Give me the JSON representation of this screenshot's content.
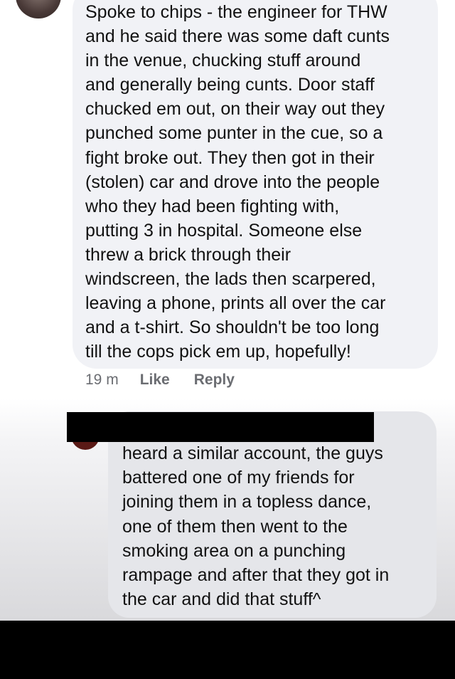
{
  "comment_1": {
    "text": "Spoke to chips - the engineer for THW\nand he said there was some daft cunts\nin the venue, chucking stuff around\nand generally being cunts. Door staff\nchucked em out, on their way out they\npunched some punter in the cue, so a\nfight broke out. They then got in their\n(stolen) car and drove into the people\nwho they had been fighting with,\nputting 3 in hospital. Someone else\nthrew a brick through their\nwindscreen, the lads then scarpered,\nleaving a phone, prints all over the car\nand a t-shirt. So shouldn't be too long\ntill the cops pick em up, hopefully!",
    "timestamp": "19 m",
    "like_label": "Like",
    "reply_label": "Reply"
  },
  "comment_2": {
    "text": "heard a similar account, the guys\nbattered one of my friends for\njoining them in a topless dance,\none of them then went to the\nsmoking area on a punching\nrampage and after that they got in\nthe car and did that stuff^"
  },
  "colors": {
    "bubble_1": "#f1f2f6",
    "bubble_2": "#e5e6ea",
    "action_text": "#6b6d72",
    "redaction": "#000000"
  }
}
